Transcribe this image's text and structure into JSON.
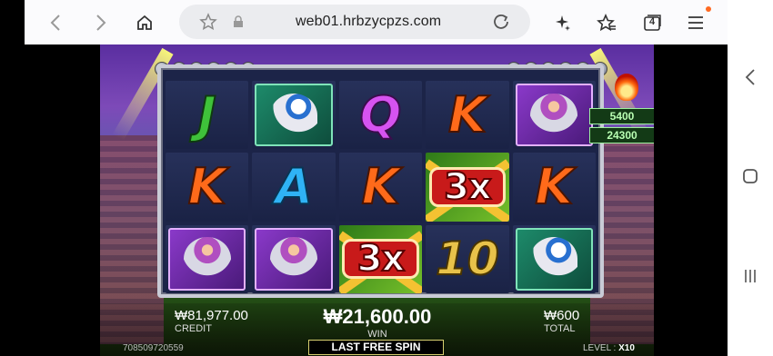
{
  "browser": {
    "url": "web01.hrbzycpzs.com",
    "tab_count": "4",
    "icons": [
      "back-icon",
      "forward-icon",
      "home-icon",
      "bookmark-star-icon",
      "lock-icon",
      "reload-icon",
      "sparkle-icon",
      "favorites-icon",
      "tabs-icon",
      "menu-icon"
    ]
  },
  "system_nav": {
    "icons": [
      "back-chevron-icon",
      "home-square-icon",
      "recents-icon"
    ]
  },
  "game": {
    "reels": [
      [
        "J",
        "player-green",
        "Q",
        "K",
        "player-purple"
      ],
      [
        "K",
        "A",
        "K",
        "3x",
        "K"
      ],
      [
        "player-purple",
        "player-purple",
        "3x",
        "10",
        "player-green"
      ]
    ],
    "multiplier_label": "3x",
    "jackpots": [
      "5400",
      "24300"
    ],
    "credit_value": "₩81,977.00",
    "credit_label": "CREDIT",
    "win_value": "₩21,600.00",
    "win_label": "WIN",
    "total_value": "₩600",
    "total_label": "TOTAL",
    "spin_status": "LAST FREE SPIN",
    "round_id": "708509720559",
    "level_label": "LEVEL :",
    "level_value": "X10"
  },
  "colors": {
    "accent_orange": "#ff6a22",
    "frame": "#c9cbd6"
  }
}
